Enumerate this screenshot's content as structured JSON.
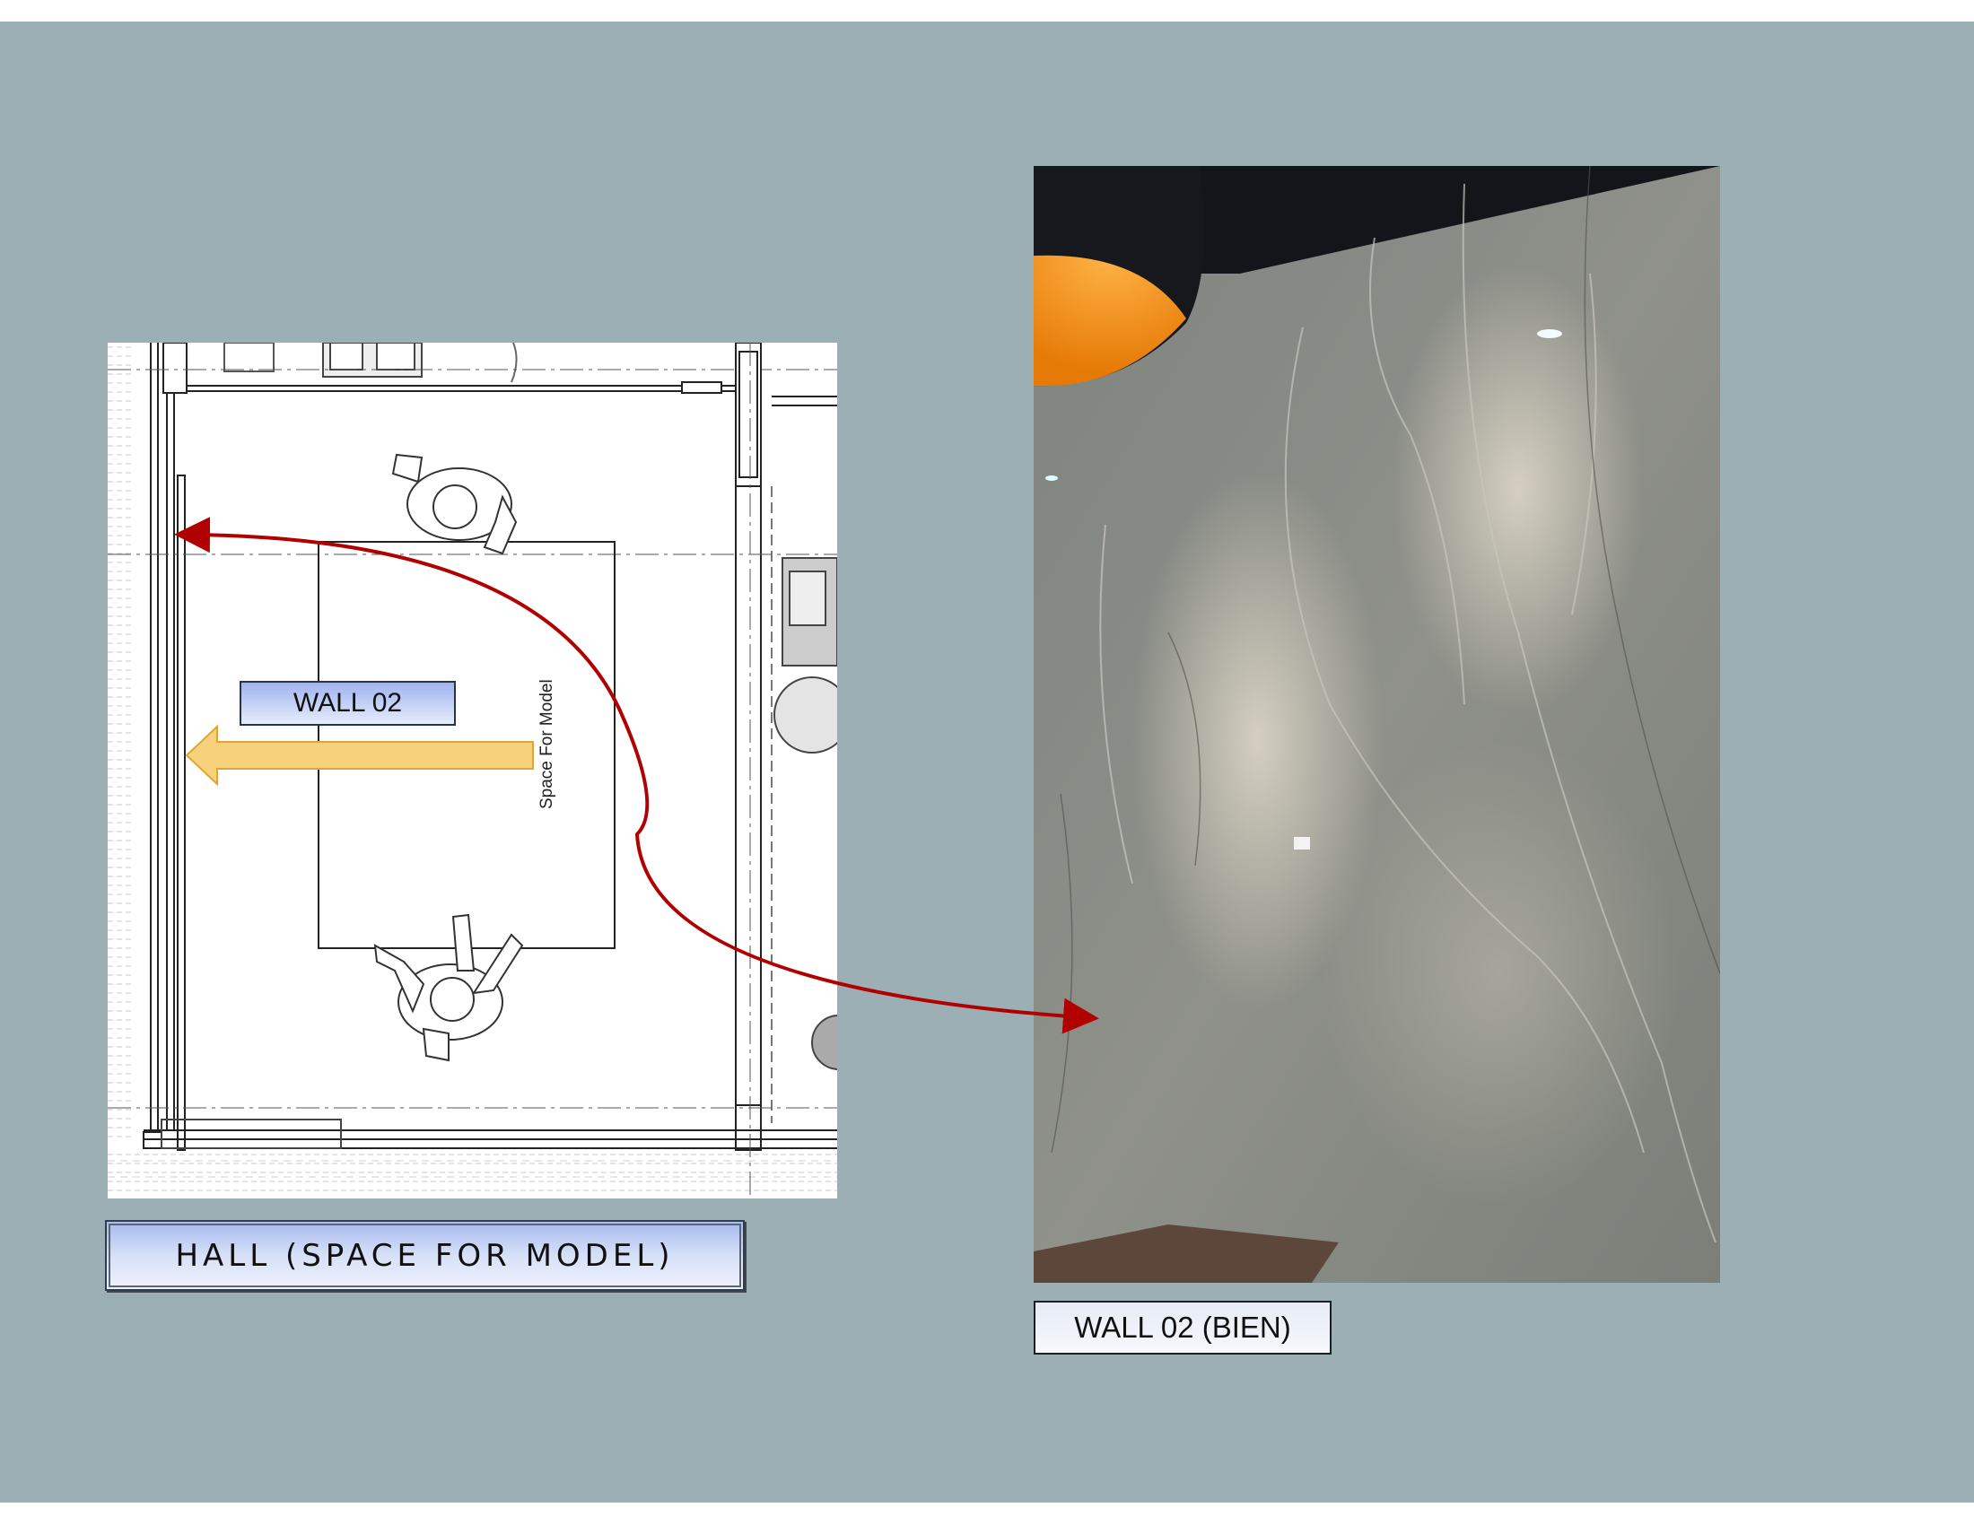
{
  "floorplan": {
    "wall_label": "WALL 02",
    "model_space_label": "Space For Model"
  },
  "captions": {
    "hall": "HALL (SPACE FOR MODEL)",
    "wall": "WALL 02 (BIEN)"
  },
  "colors": {
    "background": "#9bafb5",
    "link_arrow": "#b00000",
    "direction_arrow": "#f7d27a",
    "lamp_inner": "#f6901c",
    "wall_stone": "#8c8e85"
  }
}
